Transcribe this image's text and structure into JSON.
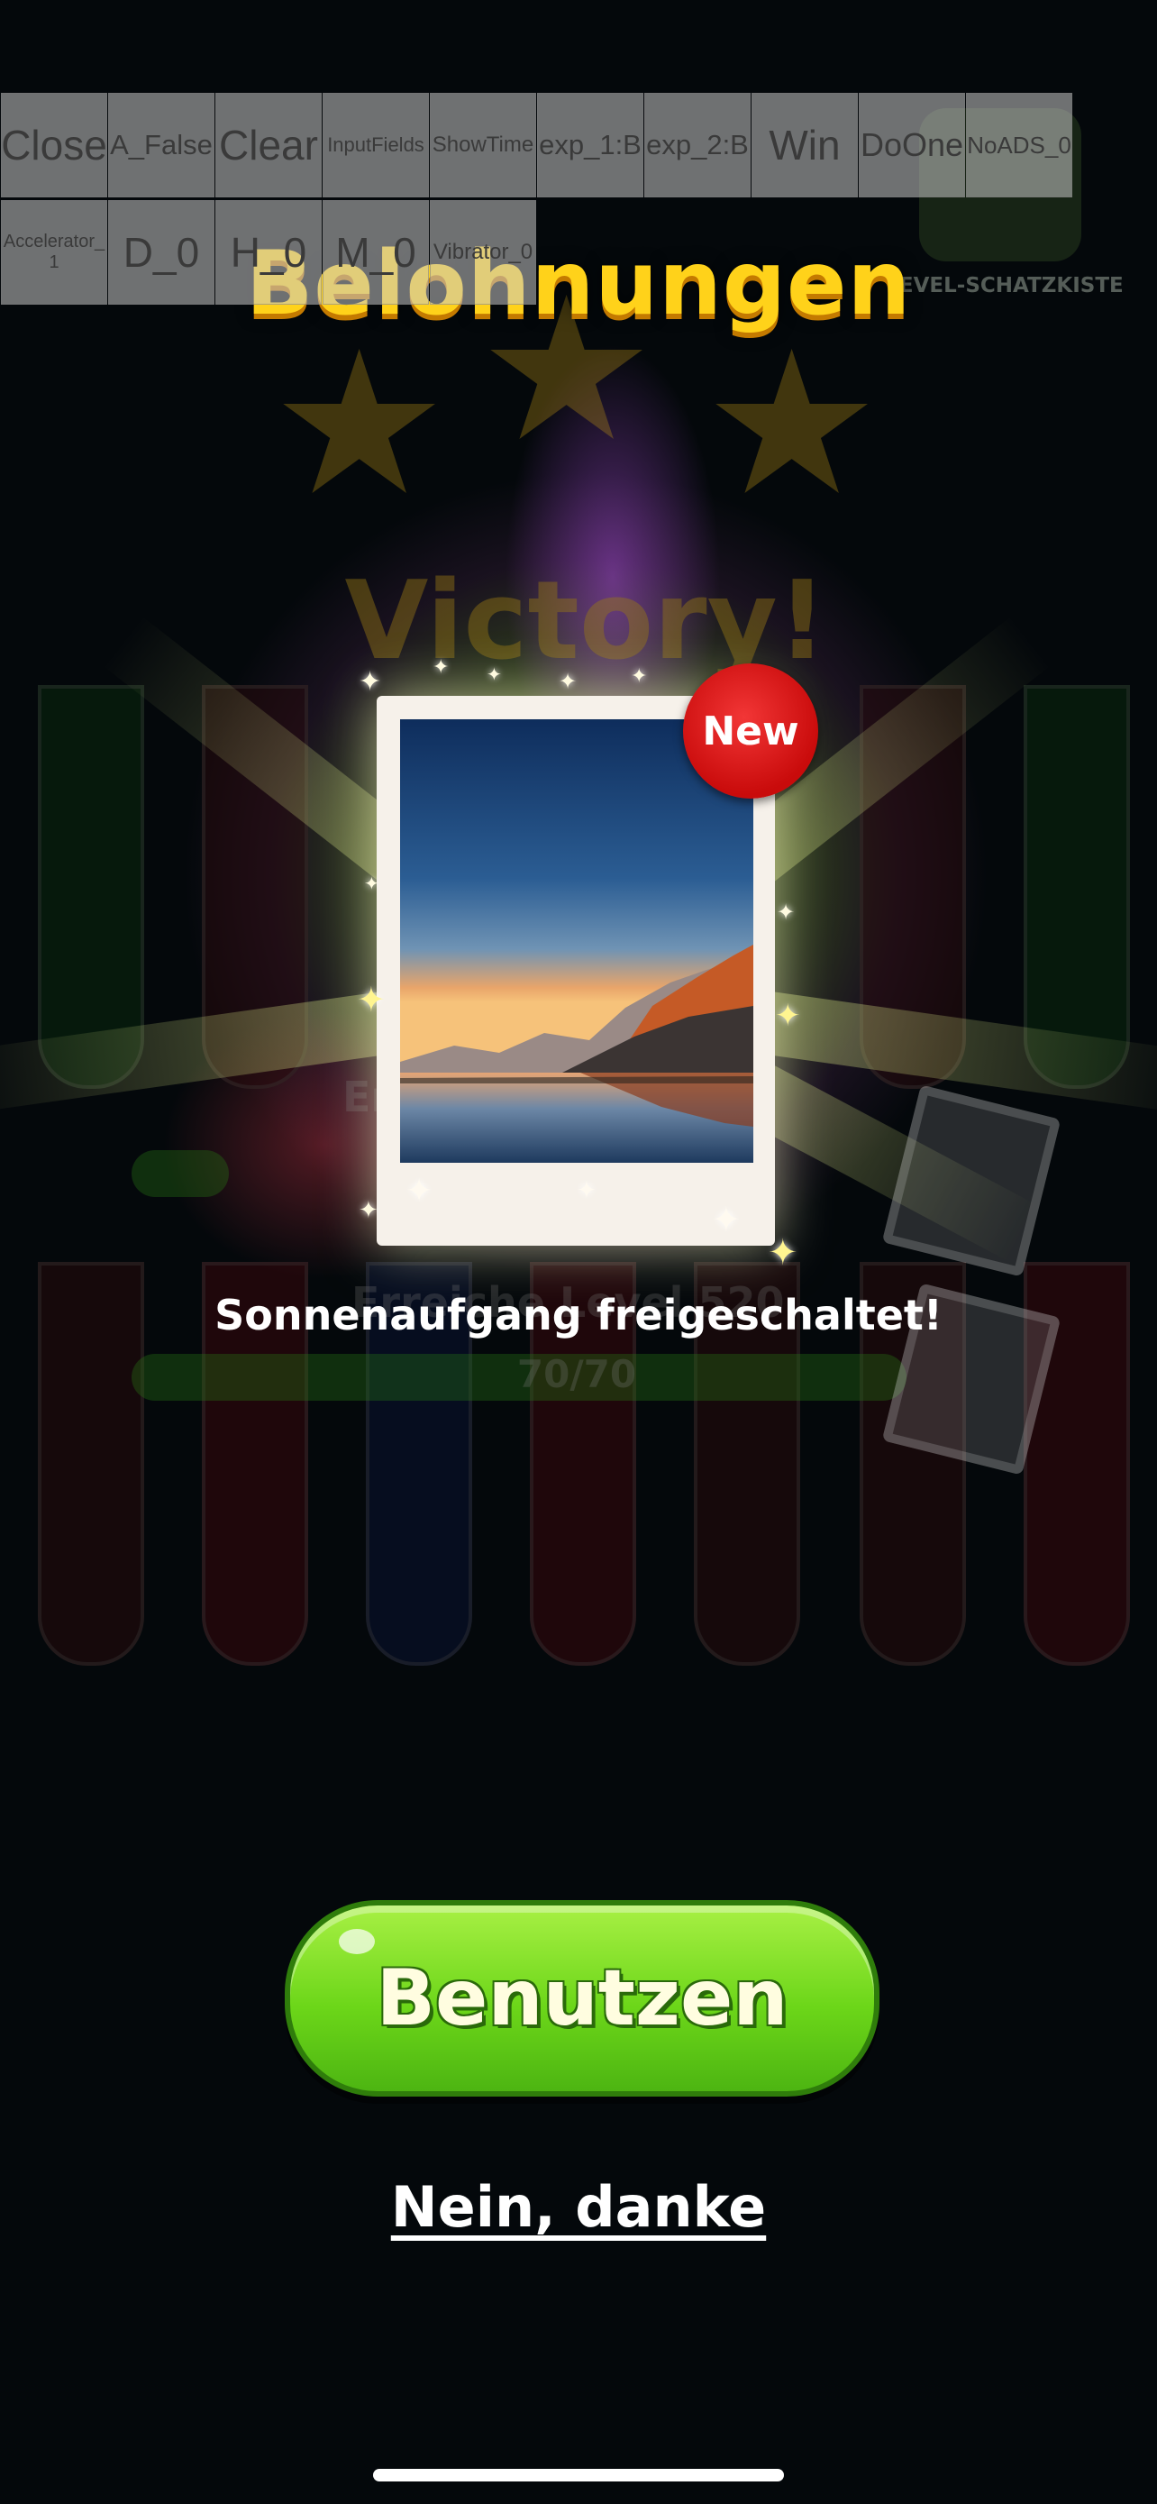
{
  "debug_toolbar": {
    "row1": [
      "Close",
      "A_False",
      "Clear",
      "InputFields",
      "ShowTime",
      "exp_1:B",
      "exp_2:B",
      "Win",
      "DoOne",
      "NoADS_0"
    ],
    "row2": [
      "Accelerator_1",
      "D_0",
      "H_0",
      "M_0",
      "Vibrator_0"
    ]
  },
  "title": "Belohnungen",
  "chest_label": "LEVEL-SCHATZKISTE",
  "background": {
    "victory": "Victory!",
    "progress_label": "70/70",
    "reach_level": "Erreiche Level 520"
  },
  "card": {
    "badge": "New",
    "caption": "Sonnenaufgang freigeschaltet!"
  },
  "buttons": {
    "use": "Benutzen",
    "no_thanks": "Nein, danke"
  },
  "colors": {
    "title": "#ffd21a",
    "use_button": "#6cd619",
    "badge": "#e01818",
    "background": "#04080b"
  }
}
